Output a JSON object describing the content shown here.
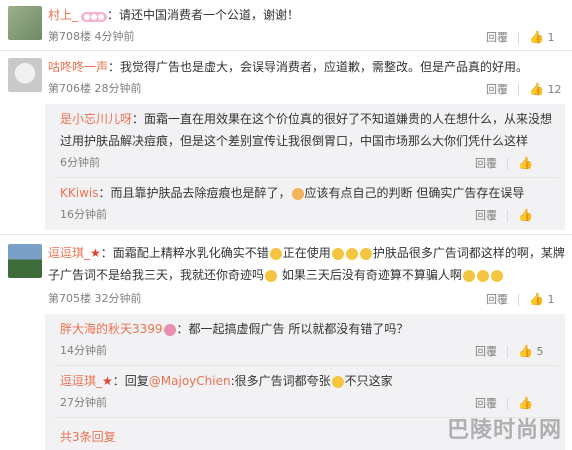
{
  "comments": [
    {
      "user": "村上_",
      "text": "：请还中国消费者一个公道，谢谢！",
      "floor": "第708楼",
      "time": "4分钟前",
      "reply_label": "回覆",
      "likes": "1"
    },
    {
      "user": "咕咚咚一声",
      "text": "：我觉得广告也是虚大，会误导消费者，应道歉，需整改。但是产品真的好用。",
      "floor": "第706楼",
      "time": "28分钟前",
      "reply_label": "回覆",
      "likes": "12"
    },
    {
      "user": "逗逗琪_",
      "text_line1": "：面霜配上精粹水乳化确实不错",
      "text_line1b": "正在使用",
      "text_line1c": "护肤品很多广告词都这样的啊，某牌",
      "text_line2": "子广告词不是给我三天，我就还你奇迹吗",
      "text_line2b": " 如果三天后没有奇迹算不算骗人啊",
      "floor": "第705楼",
      "time": "32分钟前",
      "reply_label": "回覆",
      "likes": "1"
    }
  ],
  "replies": [
    {
      "user": "是小忘川儿呀",
      "text_line1": "：面霜一直在用效果在这个价位真的很好了不知道嫌贵的人在想什么，从来没想",
      "text_line2": "过用护肤品解决痘痕，但是这个差别宣传让我很倒胃口，中国市场那么大你们凭什么这样",
      "time": "6分钟前",
      "reply_label": "回覆",
      "likes": ""
    },
    {
      "user": "KKiwis",
      "text_a": "：而且靠护肤品去除痘痕也是醉了，",
      "text_b": "应该有点自己的判断  但确实广告存在误导",
      "time": "16分钟前",
      "reply_label": "回覆",
      "likes": ""
    },
    {
      "user": "胖大海的秋天3399",
      "text": "：都一起搞虚假广告 所以就都没有错了吗？",
      "time": "14分钟前",
      "reply_label": "回覆",
      "likes": "5"
    },
    {
      "user": "逗逗琪_",
      "text_a": "：回复",
      "mention": "@MajoyChien",
      "text_b": ":很多广告词都夸张",
      "text_c": "不只这家",
      "time": "27分钟前",
      "reply_label": "回覆",
      "likes": ""
    }
  ],
  "footer": {
    "more_replies": "共3条回复"
  },
  "watermark": "巴陵时尚网"
}
